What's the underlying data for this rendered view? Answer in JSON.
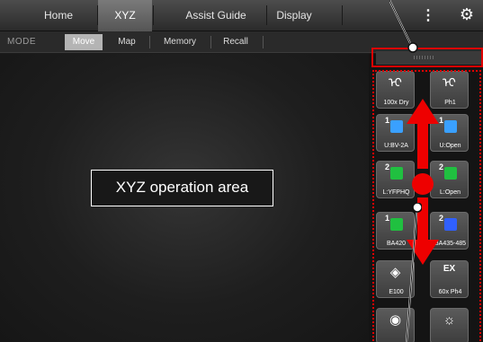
{
  "topbar": {
    "tabs": [
      "Home",
      "XYZ",
      "Assist Guide",
      "Display"
    ],
    "active_tab": "XYZ"
  },
  "modebar": {
    "label": "MODE",
    "buttons": [
      "Move",
      "Map",
      "Memory",
      "Recall"
    ],
    "active": "Move"
  },
  "operation_area": {
    "label": "XYZ operation area"
  },
  "panel": {
    "tiles": [
      {
        "label": "100x Dry",
        "icon": "objective-icon"
      },
      {
        "label": "Ph1",
        "icon": "objective-icon"
      },
      {
        "label": "U:BV-2A",
        "num": "1",
        "cube_color": "#3aa0ff"
      },
      {
        "label": "U:Open",
        "num": "1",
        "cube_color": "#3aa0ff"
      },
      {
        "label": "L:YFPHQ",
        "num": "2",
        "cube_color": "#20c040"
      },
      {
        "label": "L:Open",
        "num": "2",
        "cube_color": "#20c040"
      },
      {
        "label": "BA420",
        "num": "1",
        "cube_color": "#20c040"
      },
      {
        "label": "BA435-485",
        "num": "2",
        "cube_color": "#3060ff"
      },
      {
        "label": "E100",
        "icon": "lamp-icon"
      },
      {
        "label": "60x Ph4",
        "big": "EX"
      }
    ]
  },
  "colors": {
    "highlight": "#e00000",
    "active_mode": "#b4b4b4"
  }
}
